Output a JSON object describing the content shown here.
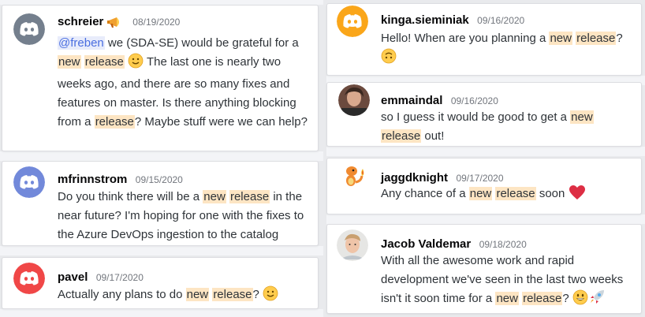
{
  "colors": {
    "discord_gray": "#747f8d",
    "discord_blurple": "#7289da",
    "discord_yellow": "#faa61a",
    "discord_red": "#f04747",
    "highlight": "#fde5c3"
  },
  "messages": [
    {
      "user": "schreier",
      "badge_icon": "megaphone-icon",
      "date": "08/19/2020",
      "avatar": "discord-gray",
      "parts": [
        {
          "m": "@freben"
        },
        {
          "t": " we (SDA-SE) would be grateful for a "
        },
        {
          "h": "new"
        },
        {
          "t": " "
        },
        {
          "h": "release"
        },
        {
          "t": " "
        },
        {
          "e": "slightly-smiling-face"
        },
        {
          "t": " The last one is nearly two weeks ago, and there are so many fixes and features on master. Is there anything blocking from a "
        },
        {
          "h": "release"
        },
        {
          "t": "? Maybe stuff were we can help?"
        }
      ]
    },
    {
      "user": "kinga.sieminiak",
      "date": "09/16/2020",
      "avatar": "discord-yellow",
      "parts": [
        {
          "t": "Hello! When are you planning a "
        },
        {
          "h": "new"
        },
        {
          "t": " "
        },
        {
          "h": "release"
        },
        {
          "t": "? "
        },
        {
          "e": "upside-down-face"
        }
      ]
    },
    {
      "user": "emmaindal",
      "date": "09/16/2020",
      "avatar": "photo",
      "parts": [
        {
          "t": "so I guess it would be good to get a "
        },
        {
          "h": "new"
        },
        {
          "t": " "
        },
        {
          "h": "release"
        },
        {
          "t": " out!"
        }
      ]
    },
    {
      "user": "mfrinnstrom",
      "date": "09/15/2020",
      "avatar": "discord-blurple",
      "parts": [
        {
          "t": "Do you think there will be a "
        },
        {
          "h": "new"
        },
        {
          "t": " "
        },
        {
          "h": "release"
        },
        {
          "t": " in the near future? I'm hoping for one with the fixes to the Azure DevOps ingestion to the catalog"
        }
      ]
    },
    {
      "user": "jaggdknight",
      "date": "09/17/2020",
      "avatar": "charmander",
      "parts": [
        {
          "t": "Any chance of a "
        },
        {
          "h": "new"
        },
        {
          "t": " "
        },
        {
          "h": "release"
        },
        {
          "t": " soon "
        },
        {
          "e": "red-heart"
        }
      ]
    },
    {
      "user": "pavel",
      "date": "09/17/2020",
      "avatar": "discord-red",
      "parts": [
        {
          "t": "Actually any plans to do "
        },
        {
          "h": "new"
        },
        {
          "t": " "
        },
        {
          "h": "release"
        },
        {
          "t": "? "
        },
        {
          "e": "slightly-smiling-face"
        }
      ]
    },
    {
      "user": "Jacob Valdemar",
      "date": "09/18/2020",
      "avatar": "photo",
      "parts": [
        {
          "t": "With all the awesome work and rapid development we've seen in the last two weeks isn't it soon time for a "
        },
        {
          "h": "new"
        },
        {
          "t": " "
        },
        {
          "h": "release"
        },
        {
          "t": "? "
        },
        {
          "e": "grinning-face"
        },
        {
          "e": "rocket"
        }
      ]
    }
  ]
}
